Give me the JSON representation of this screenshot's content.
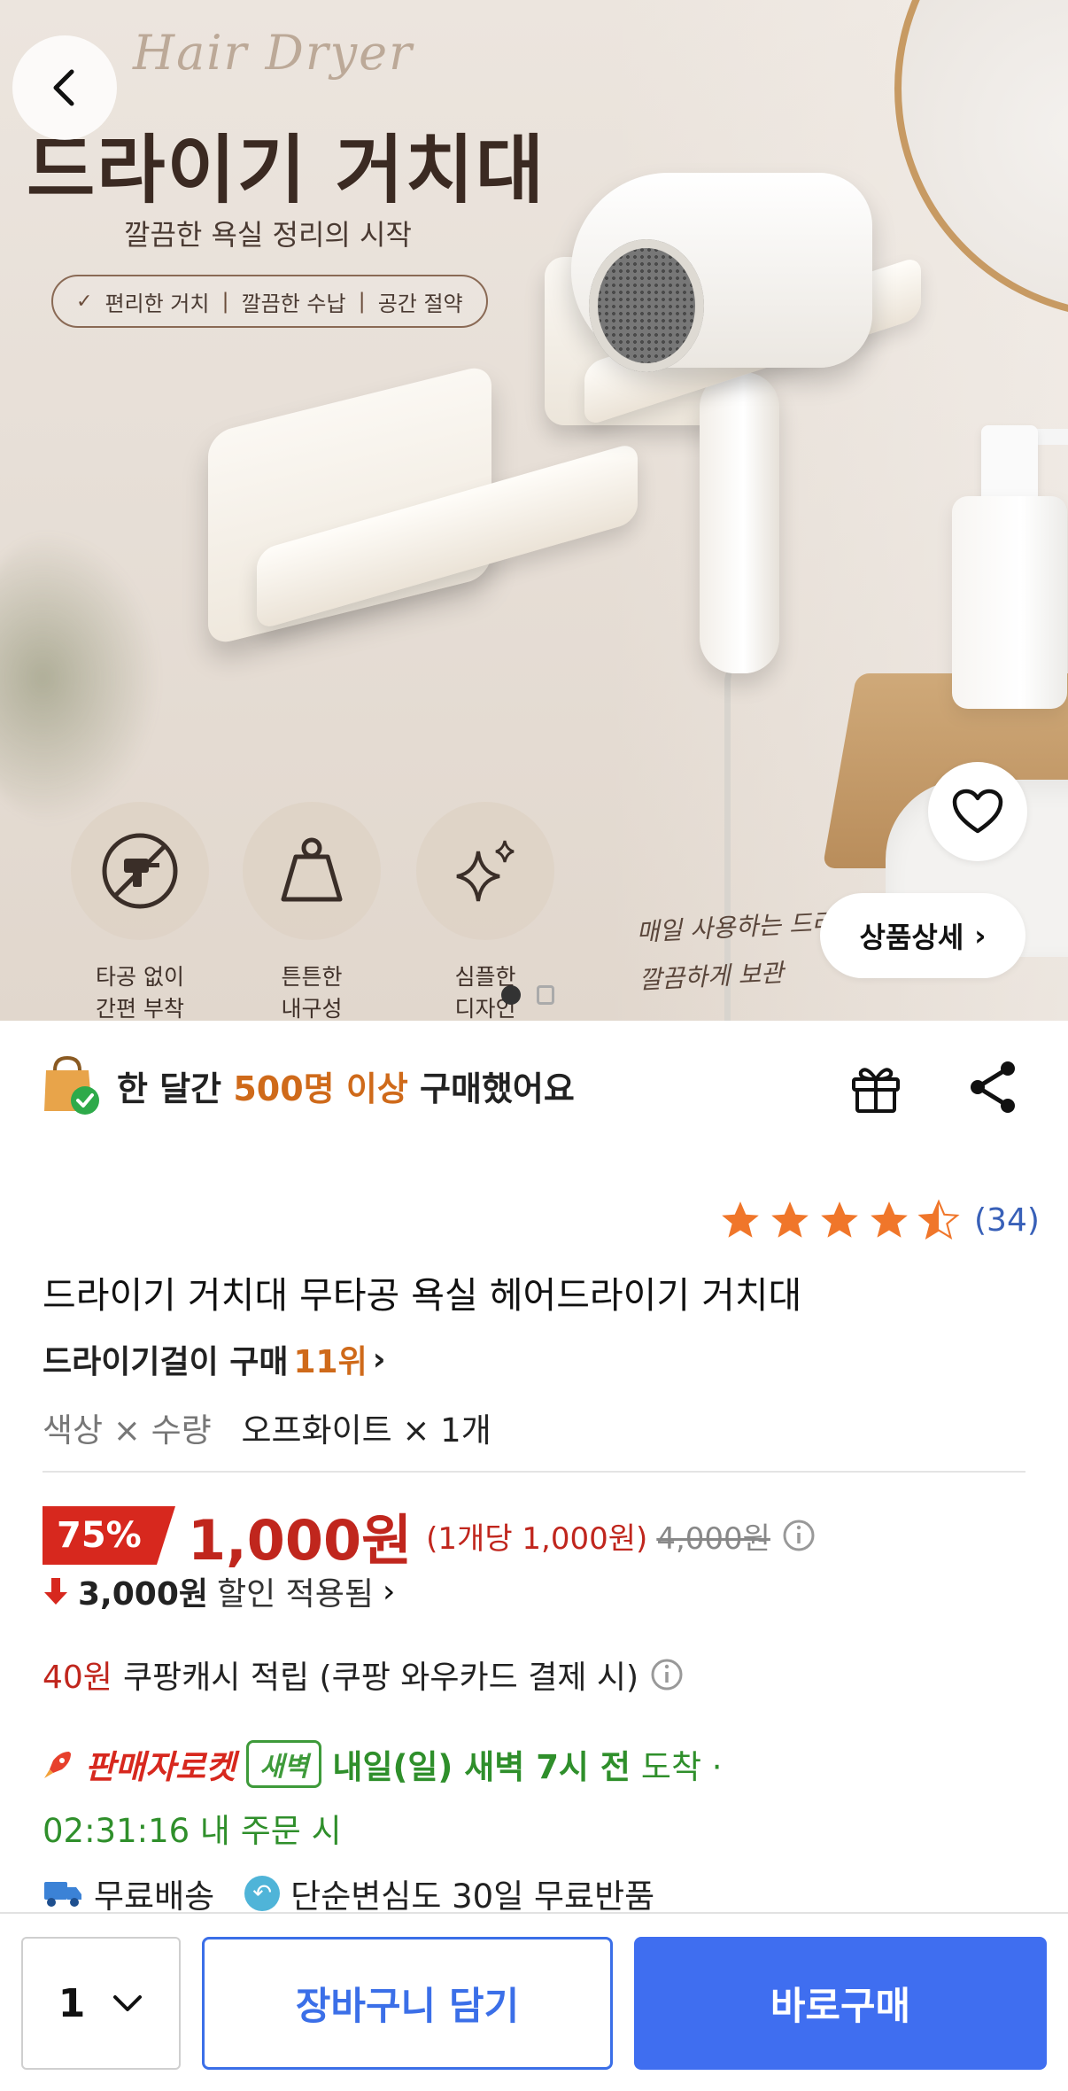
{
  "hero": {
    "script_title": "Hair Dryer",
    "title": "드라이기 거치대",
    "subtitle": "깔끔한 욕실 정리의 시작",
    "pill": {
      "check": "✓",
      "items": [
        "편리한 거치",
        "깔끔한 수납",
        "공간 절약"
      ]
    },
    "features": [
      {
        "icon": "no-drill-icon",
        "line1": "타공 없이",
        "line2": "간편 부착"
      },
      {
        "icon": "weight-icon",
        "line1": "튼튼한",
        "line2": "내구성"
      },
      {
        "icon": "sparkle-icon",
        "line1": "심플한",
        "line2": "디자인"
      }
    ],
    "handwriting": {
      "line1": "매일 사용하는 드라",
      "line2": "깔끔하게 보관"
    },
    "detail_button": "상품상세",
    "detail_chevron": "›"
  },
  "buyers": {
    "prefix": "한 달간",
    "highlight": "500명 이상",
    "suffix": "구매했어요"
  },
  "product": {
    "rating": 4.5,
    "review_count": "(34)",
    "title": "드라이기 거치대 무타공 욕실 헤어드라이기 거치대",
    "rank_prefix": "드라이기걸이 구매",
    "rank_number": "11위",
    "rank_chevron": "›",
    "option_label": "색상 × 수량",
    "option_value": "오프화이트 × 1개"
  },
  "price": {
    "discount_pct": "75%",
    "sale_price": "1,000원",
    "unit_price": "(1개당 1,000원)",
    "original_price": "4,000원",
    "discount_amount": "3,000원",
    "discount_text": "할인 적용됨",
    "discount_chevron": "›"
  },
  "cash": {
    "amount": "40원",
    "text": "쿠팡캐시 적립 (쿠팡 와우카드 결제 시)"
  },
  "delivery": {
    "rocket_label": "판매자로켓",
    "badge": "새벽",
    "when": "내일(일) 새벽 7시 전",
    "arrive": "도착 ·",
    "countdown": "02:31:16 내 주문 시"
  },
  "shipping": {
    "free_shipping": "무료배송",
    "returns": "단순변심도 30일 무료반품"
  },
  "bottom_bar": {
    "quantity": "1",
    "cart_button": "장바구니 담기",
    "buy_button": "바로구매"
  },
  "colors": {
    "sale_red": "#c0261d",
    "accent_orange": "#cf6a1a",
    "delivery_green": "#2f8f2b",
    "primary_blue": "#3f6ef0"
  }
}
